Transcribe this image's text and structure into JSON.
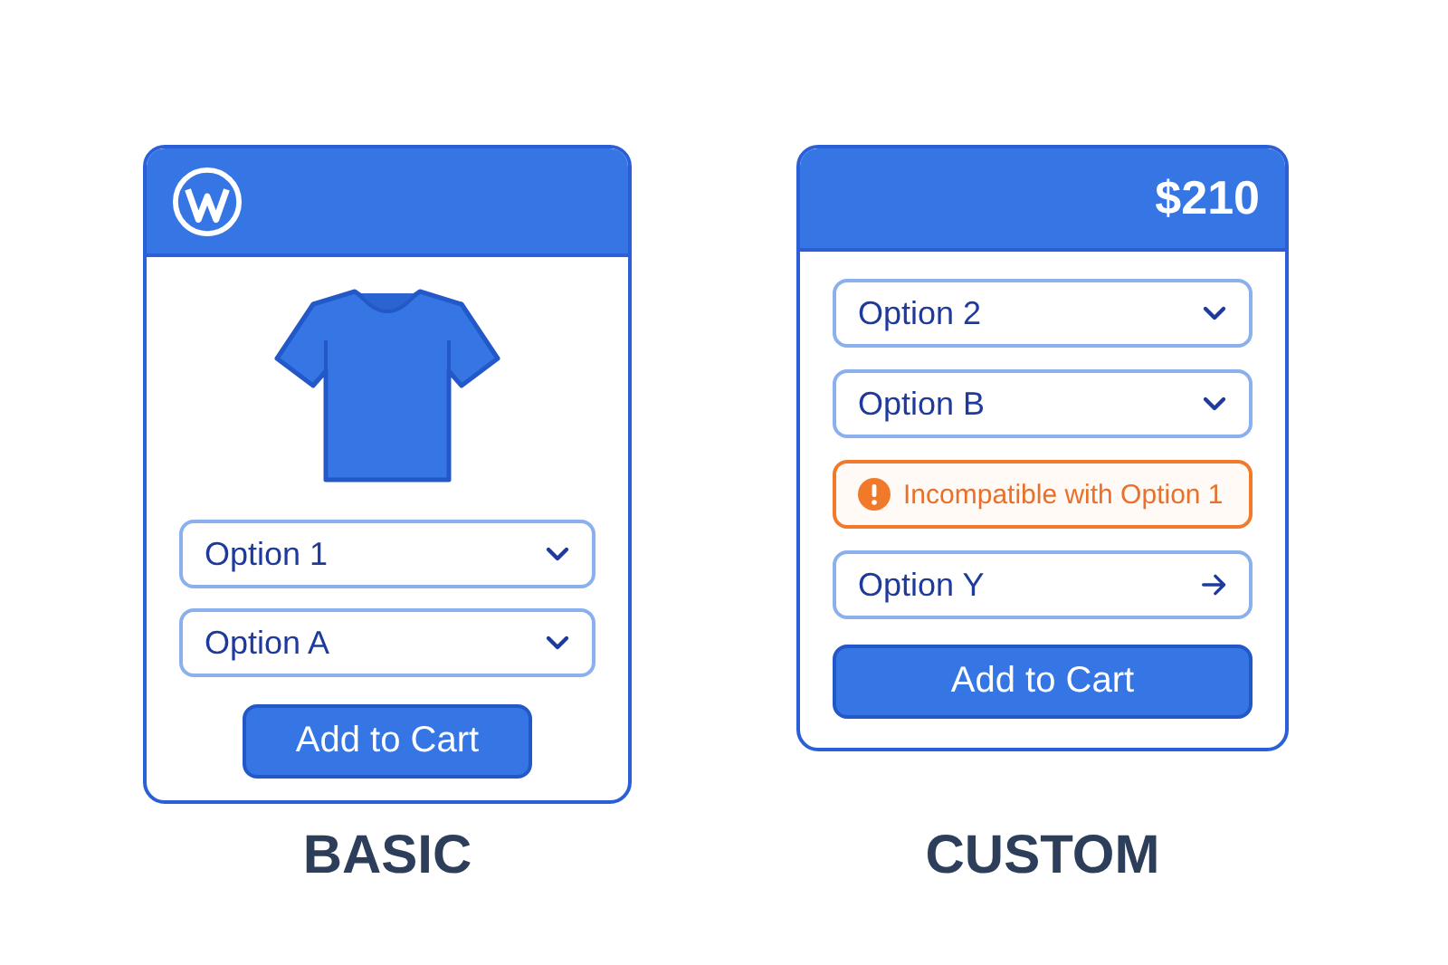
{
  "cards": [
    {
      "kind": "basic",
      "header": {
        "kind": "logo"
      },
      "product_image": {
        "kind": "tshirt"
      },
      "fields": [
        {
          "kind": "select",
          "value": "Option 1"
        },
        {
          "kind": "select",
          "value": "Option A"
        }
      ],
      "button": "Add to Cart",
      "caption": "BASIC"
    },
    {
      "kind": "custom",
      "header": {
        "kind": "price",
        "text": "$210"
      },
      "fields": [
        {
          "kind": "select",
          "value": "Option 2"
        },
        {
          "kind": "select",
          "value": "Option B"
        },
        {
          "kind": "warning",
          "text": "Incompatible with Option 1"
        },
        {
          "kind": "link",
          "value": "Option Y"
        }
      ],
      "button": "Add to Cart",
      "caption": "CUSTOM"
    }
  ]
}
